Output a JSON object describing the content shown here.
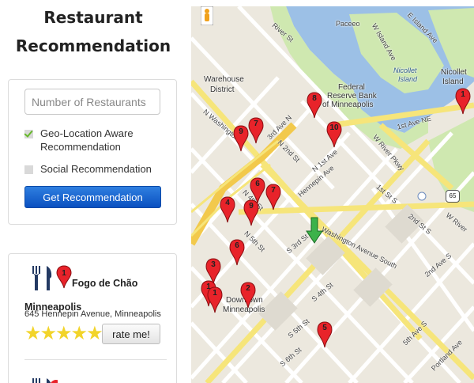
{
  "app": {
    "title_line1": "Restaurant",
    "title_line2": "Recommendation"
  },
  "form": {
    "num_placeholder": "Number of Restaurants",
    "geo_label": "Geo-Location Aware Recommendation",
    "geo_checked": true,
    "social_label": "Social Recommendation",
    "social_checked": false,
    "submit_label": "Get Recommendation"
  },
  "results": [
    {
      "rank": "1",
      "name": "Fogo de Chão Minneapolis",
      "address": "645 Hennepin Avenue, Minneapolis",
      "stars": "★★★★★",
      "rating": 5,
      "rate_label": "rate me!"
    }
  ],
  "map": {
    "labels": {
      "warehouse": "Warehouse",
      "district": "District",
      "federal1": "Federal",
      "federal2": "Reserve Bank",
      "federal3": "of Minneapolis",
      "paceeo": "Paceeo",
      "nicollet_island": "Nicollet",
      "nicollet_island2": "Island",
      "nicollet_r": "Nicollet",
      "island_r": "Island",
      "downtown": "Downtown",
      "downtown2": "Minneapolis",
      "hennepin": "Hennepin Ave",
      "washington": "Washington Avenue South",
      "river_pkwy": "W River Pkwy",
      "first_ne": "1st Ave NE",
      "w_river": "W River",
      "s3rd": "S 3rd St",
      "s4th": "S 4th St",
      "s5th": "S 5th St",
      "s6th": "S 6th St",
      "portland": "Portland Ave",
      "fifth_ave": "5th Ave S",
      "second_ave": "2nd Ave S",
      "n4th": "N 4th St",
      "n5th": "N 5th St",
      "n2nd": "N 2nd St",
      "n1st": "N 1st Ave",
      "n_washington": "N Washington",
      "third_n": "3rd Ave N",
      "first_s": "1st St S",
      "second_s": "2nd St S",
      "river_st": "River St",
      "w_island": "W Island Ave",
      "e_island": "E Island Ave"
    },
    "shield": "65",
    "pins": [
      {
        "label": "8"
      },
      {
        "label": "10"
      },
      {
        "label": "7"
      },
      {
        "label": "9"
      },
      {
        "label": "1"
      },
      {
        "label": "6"
      },
      {
        "label": "7"
      },
      {
        "label": "4"
      },
      {
        "label": "9"
      },
      {
        "label": "6"
      },
      {
        "label": "3"
      },
      {
        "label": "2"
      },
      {
        "label": "1"
      },
      {
        "label": "1"
      },
      {
        "label": "5"
      }
    ]
  }
}
